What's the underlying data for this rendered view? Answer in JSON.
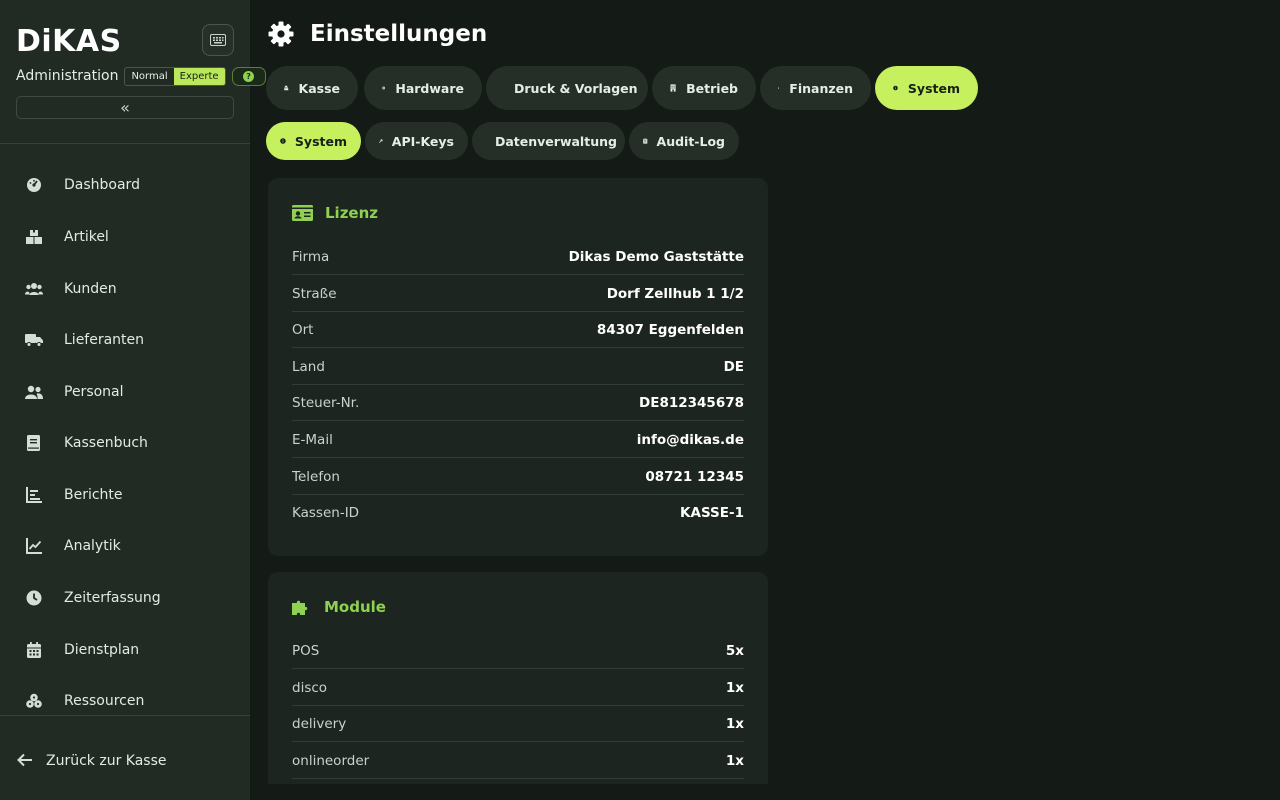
{
  "brand": {
    "logo": "DiKAS"
  },
  "sidebar": {
    "admin_label": "Administration",
    "modes": [
      "Normal",
      "Experte"
    ],
    "active_mode": "Experte",
    "help_label": "?",
    "collapse_label": "«",
    "items": [
      {
        "label": "Dashboard",
        "icon": "dashboard-icon"
      },
      {
        "label": "Artikel",
        "icon": "boxes-icon"
      },
      {
        "label": "Kunden",
        "icon": "users-icon"
      },
      {
        "label": "Lieferanten",
        "icon": "truck-icon"
      },
      {
        "label": "Personal",
        "icon": "user-group-icon"
      },
      {
        "label": "Kassenbuch",
        "icon": "book-icon"
      },
      {
        "label": "Berichte",
        "icon": "bar-chart-icon"
      },
      {
        "label": "Analytik",
        "icon": "line-chart-icon"
      },
      {
        "label": "Zeiterfassung",
        "icon": "clock-icon"
      },
      {
        "label": "Dienstplan",
        "icon": "calendar-icon"
      },
      {
        "label": "Ressourcen",
        "icon": "cubes-icon"
      }
    ],
    "back_label": "Zurück zur Kasse"
  },
  "page": {
    "title": "Einstellungen"
  },
  "tabs": [
    {
      "label": "Kasse",
      "icon": "register-icon",
      "active": false
    },
    {
      "label": "Hardware",
      "icon": "chip-icon",
      "active": false
    },
    {
      "label": "Druck & Vorlagen",
      "icon": "document-icon",
      "active": false
    },
    {
      "label": "Betrieb",
      "icon": "building-icon",
      "active": false
    },
    {
      "label": "Finanzen",
      "icon": "coins-icon",
      "active": false
    },
    {
      "label": "System",
      "icon": "info-icon",
      "active": true
    }
  ],
  "subtabs": [
    {
      "label": "System",
      "icon": "info-icon",
      "active": true
    },
    {
      "label": "API-Keys",
      "icon": "key-icon",
      "active": false
    },
    {
      "label": "Datenverwaltung",
      "icon": "history-icon",
      "active": false
    },
    {
      "label": "Audit-Log",
      "icon": "clipboard-icon",
      "active": false
    }
  ],
  "license": {
    "title": "Lizenz",
    "rows": [
      {
        "key": "Firma",
        "value": "Dikas Demo Gaststätte"
      },
      {
        "key": "Straße",
        "value": "Dorf Zellhub 1 1/2"
      },
      {
        "key": "Ort",
        "value": "84307 Eggenfelden"
      },
      {
        "key": "Land",
        "value": "DE"
      },
      {
        "key": "Steuer-Nr.",
        "value": "DE812345678"
      },
      {
        "key": "E-Mail",
        "value": "info@dikas.de"
      },
      {
        "key": "Telefon",
        "value": "08721 12345"
      },
      {
        "key": "Kassen-ID",
        "value": "KASSE-1"
      }
    ]
  },
  "modules": {
    "title": "Module",
    "rows": [
      {
        "key": "POS",
        "value": "5x"
      },
      {
        "key": "disco",
        "value": "1x"
      },
      {
        "key": "delivery",
        "value": "1x"
      },
      {
        "key": "onlineorder",
        "value": "1x"
      }
    ]
  },
  "colors": {
    "accent": "#c6f05e",
    "accent_text": "#8fd150",
    "sidebar_bg": "#212b24",
    "main_bg": "#141a16"
  }
}
